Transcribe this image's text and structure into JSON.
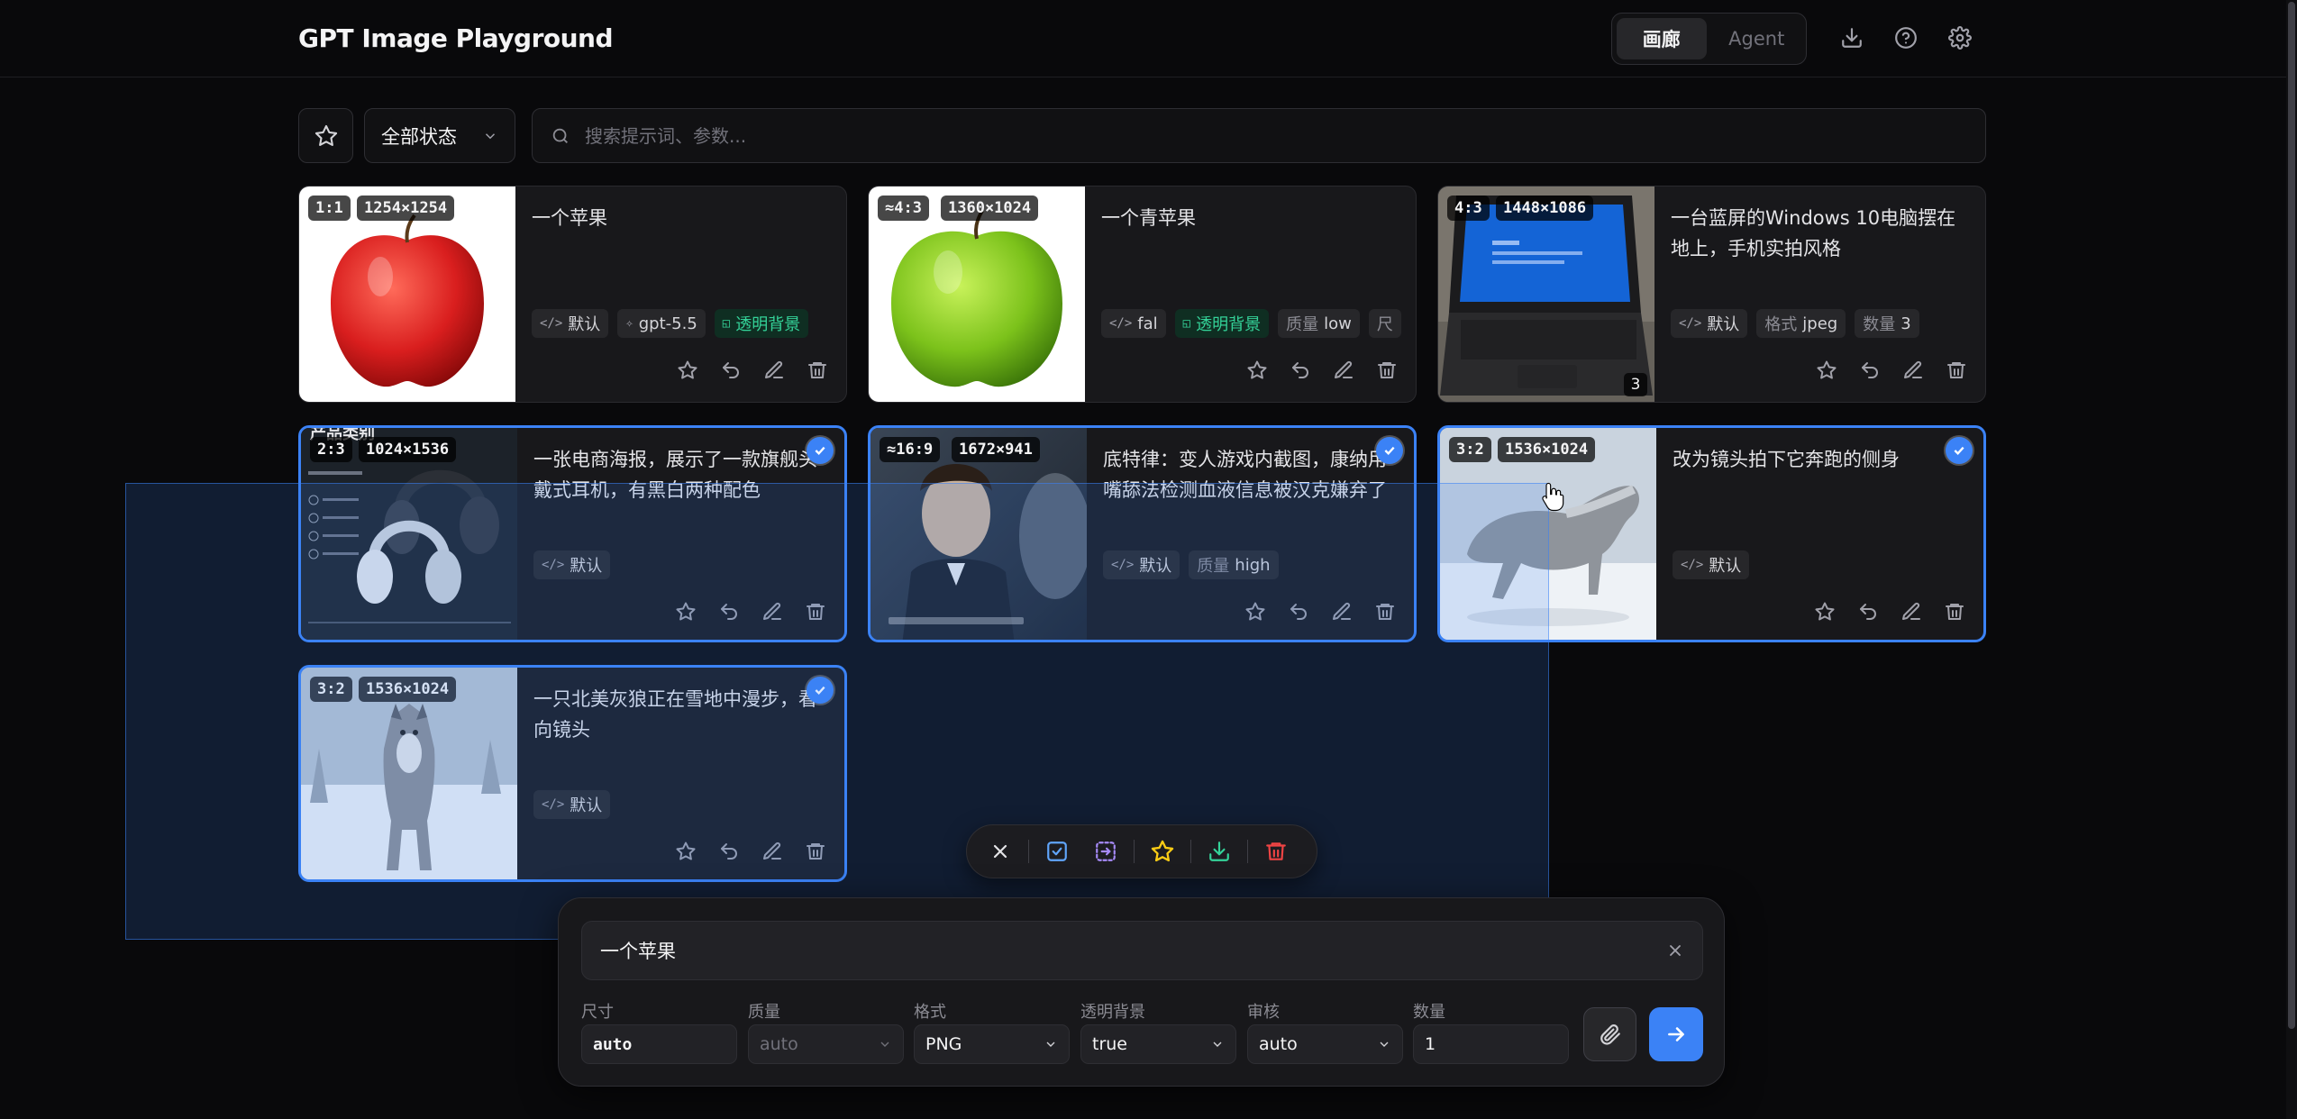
{
  "app": {
    "title": "GPT Image Playground"
  },
  "header": {
    "tabs": [
      {
        "label": "画廊",
        "active": true
      },
      {
        "label": "Agent",
        "active": false
      }
    ],
    "icons": [
      "download-icon",
      "help-icon",
      "settings-icon"
    ]
  },
  "toolbar": {
    "status_filter": "全部状态",
    "search_placeholder": "搜索提示词、参数..."
  },
  "colors": {
    "accent": "#3b82f6",
    "green": "#34d399",
    "star": "#facc15",
    "danger": "#ef4444",
    "batch_purple": "#a78bfa"
  },
  "cards": [
    {
      "ratio": "1:1",
      "size": "1254×1254",
      "prompt": "一个苹果",
      "chips": [
        {
          "icon": "code-icon",
          "text": "默认"
        },
        {
          "icon": "sparkle-icon",
          "text": "gpt-5.5"
        },
        {
          "icon": "transparent-bg-icon",
          "text": "透明背景",
          "green": true
        }
      ],
      "selected": false
    },
    {
      "ratio": "≈4:3",
      "size": "1360×1024",
      "prompt": "一个青苹果",
      "chips": [
        {
          "icon": "code-icon",
          "text": "fal"
        },
        {
          "icon": "transparent-bg-icon",
          "text": "透明背景",
          "green": true
        },
        {
          "key": "质量",
          "text": "low"
        },
        {
          "key": "尺",
          "text": ""
        }
      ],
      "selected": false
    },
    {
      "ratio": "4:3",
      "size": "1448×1086",
      "prompt": "一台蓝屏的Windows 10电脑摆在地上，手机实拍风格",
      "count": "3",
      "chips": [
        {
          "icon": "code-icon",
          "text": "默认"
        },
        {
          "key": "格式",
          "text": "jpeg"
        },
        {
          "key": "数量",
          "text": "3"
        }
      ],
      "selected": false
    },
    {
      "ratio": "2:3",
      "size": "1024×1536",
      "prompt": "一张电商海报，展示了一款旗舰头戴式耳机，有黑白两种配色",
      "chips": [
        {
          "icon": "code-icon",
          "text": "默认"
        }
      ],
      "selected": true
    },
    {
      "ratio": "≈16:9",
      "size": "1672×941",
      "prompt": "底特律：变人游戏内截图，康纳用嘴舔法检测血液信息被汉克嫌弃了",
      "chips": [
        {
          "icon": "code-icon",
          "text": "默认"
        },
        {
          "key": "质量",
          "text": "high"
        }
      ],
      "selected": true
    },
    {
      "ratio": "3:2",
      "size": "1536×1024",
      "prompt": "改为镜头拍下它奔跑的侧身",
      "chips": [
        {
          "icon": "code-icon",
          "text": "默认"
        }
      ],
      "selected": true
    },
    {
      "ratio": "3:2",
      "size": "1536×1024",
      "prompt": "一只北美灰狼正在雪地中漫步，看向镜头",
      "chips": [
        {
          "icon": "code-icon",
          "text": "默认"
        }
      ],
      "selected": true
    }
  ],
  "poster_text": {
    "title": "产品类别"
  },
  "batch_bar": [
    "close-icon",
    "select-all-icon",
    "select-range-icon",
    "star-icon",
    "download-icon",
    "trash-icon"
  ],
  "composer": {
    "prompt_value": "一个苹果",
    "params": [
      {
        "label": "尺寸",
        "value": "auto",
        "type": "input"
      },
      {
        "label": "质量",
        "value": "auto",
        "type": "select",
        "disabled": true
      },
      {
        "label": "格式",
        "value": "PNG",
        "type": "select"
      },
      {
        "label": "透明背景",
        "value": "true",
        "type": "select"
      },
      {
        "label": "审核",
        "value": "auto",
        "type": "select"
      },
      {
        "label": "数量",
        "value": "1",
        "type": "input"
      }
    ]
  }
}
